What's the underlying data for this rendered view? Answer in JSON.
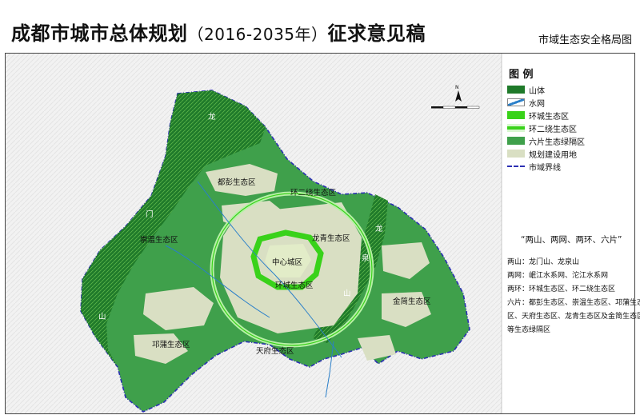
{
  "header": {
    "title_main": "成都市城市总体规划",
    "title_years": "（2016-2035年）",
    "title_tail": "征求意见稿",
    "subtitle": "市域生态安全格局图"
  },
  "legend": {
    "title": "图  例",
    "items": [
      {
        "label": "山体",
        "color": "#1f7a2a",
        "icon": "mountain-swatch"
      },
      {
        "label": "水网",
        "color": "#2a7fc9",
        "icon": "water-swatch"
      },
      {
        "label": "环城生态区",
        "color": "#39d21a",
        "icon": "ring-ecozone-swatch"
      },
      {
        "label": "环二绕生态区",
        "color": "#7ee36a",
        "icon": "second-ring-swatch"
      },
      {
        "label": "六片生态绿隔区",
        "color": "#3fa04b",
        "icon": "six-zones-swatch"
      },
      {
        "label": "规划建设用地",
        "color": "#d9dfc3",
        "icon": "construction-land-swatch"
      },
      {
        "label": "市域界线",
        "color": "#2b2fb3",
        "icon": "boundary-swatch"
      }
    ]
  },
  "summary": {
    "title": "“两山、两网、两环、六片”",
    "lines": [
      "两山：龙门山、龙泉山",
      "两网：岷江水系网、沱江水系网",
      "两环：环城生态区、环二绕生态区",
      "六片：都彭生态区、崇温生态区、邛蒲生态",
      "区、天府生态区、龙青生态区及金简生态区",
      "等生态绿隔区"
    ]
  },
  "map_labels": {
    "long1": "龙",
    "men": "门",
    "shan1": "山",
    "long2": "龙",
    "quan": "泉",
    "shan2": "山",
    "dupeng": "都彭生态区",
    "chongwen": "崇温生态区",
    "qiongpu": "邛蒲生态区",
    "tianfu": "天府生态区",
    "longqing": "龙青生态区",
    "jinjian": "金简生态区",
    "huaner": "环二绕生态区",
    "huancheng": "环城生态区",
    "zhongxin": "中心城区"
  },
  "compass": {
    "north": "N"
  },
  "colors": {
    "mountain": "#1f7a2a",
    "zone": "#3fa04b",
    "ring": "#39d21a",
    "ring2": "#b8f0a8",
    "build": "#d9dfc3",
    "water": "#2a7fc9",
    "boundary": "#2b2fb3"
  }
}
